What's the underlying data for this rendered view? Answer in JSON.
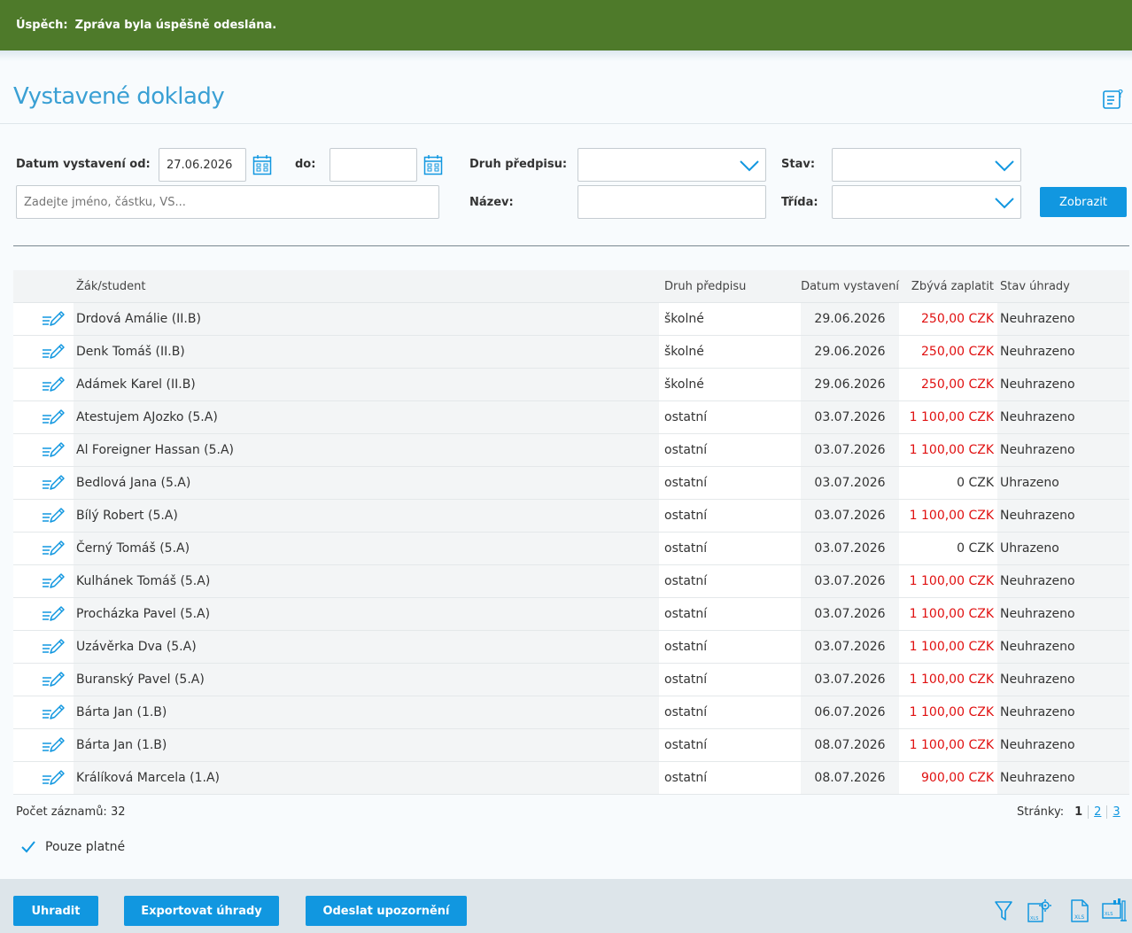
{
  "banner": {
    "label": "Úspěch:",
    "message": "Zpráva byla úspěšně odeslána."
  },
  "page": {
    "title": "Vystavené doklady"
  },
  "filters": {
    "date_from_label": "Datum vystavení od:",
    "date_from_value": "27.06.2026",
    "date_to_label": "do:",
    "date_to_value": "",
    "druh_label": "Druh předpisu:",
    "druh_value": "",
    "stav_label": "Stav:",
    "stav_value": "",
    "search_placeholder": "Zadejte jméno, částku, VS...",
    "nazev_label": "Název:",
    "nazev_value": "",
    "trida_label": "Třída:",
    "trida_value": "",
    "show_button": "Zobrazit"
  },
  "table": {
    "headers": {
      "student": "Žák/student",
      "druh": "Druh předpisu",
      "datum": "Datum vystavení",
      "zbyva": "Zbývá zaplatit",
      "stav": "Stav úhrady"
    },
    "rows": [
      {
        "name": "Drdová Amálie (II.B)",
        "druh": "školné",
        "datum": "29.06.2026",
        "zbyva": "250,00 CZK",
        "stav": "Neuhrazeno",
        "due": true
      },
      {
        "name": "Denk Tomáš (II.B)",
        "druh": "školné",
        "datum": "29.06.2026",
        "zbyva": "250,00 CZK",
        "stav": "Neuhrazeno",
        "due": true
      },
      {
        "name": "Adámek Karel (II.B)",
        "druh": "školné",
        "datum": "29.06.2026",
        "zbyva": "250,00 CZK",
        "stav": "Neuhrazeno",
        "due": true
      },
      {
        "name": "Atestujem AJozko (5.A)",
        "druh": "ostatní",
        "datum": "03.07.2026",
        "zbyva": "1 100,00 CZK",
        "stav": "Neuhrazeno",
        "due": true
      },
      {
        "name": "Al Foreigner Hassan (5.A)",
        "druh": "ostatní",
        "datum": "03.07.2026",
        "zbyva": "1 100,00 CZK",
        "stav": "Neuhrazeno",
        "due": true
      },
      {
        "name": "Bedlová Jana (5.A)",
        "druh": "ostatní",
        "datum": "03.07.2026",
        "zbyva": "0 CZK",
        "stav": "Uhrazeno",
        "due": false
      },
      {
        "name": "Bílý Robert (5.A)",
        "druh": "ostatní",
        "datum": "03.07.2026",
        "zbyva": "1 100,00 CZK",
        "stav": "Neuhrazeno",
        "due": true
      },
      {
        "name": "Černý Tomáš (5.A)",
        "druh": "ostatní",
        "datum": "03.07.2026",
        "zbyva": "0 CZK",
        "stav": "Uhrazeno",
        "due": false
      },
      {
        "name": "Kulhánek Tomáš (5.A)",
        "druh": "ostatní",
        "datum": "03.07.2026",
        "zbyva": "1 100,00 CZK",
        "stav": "Neuhrazeno",
        "due": true
      },
      {
        "name": "Procházka Pavel (5.A)",
        "druh": "ostatní",
        "datum": "03.07.2026",
        "zbyva": "1 100,00 CZK",
        "stav": "Neuhrazeno",
        "due": true
      },
      {
        "name": "Uzávěrka Dva (5.A)",
        "druh": "ostatní",
        "datum": "03.07.2026",
        "zbyva": "1 100,00 CZK",
        "stav": "Neuhrazeno",
        "due": true
      },
      {
        "name": "Buranský Pavel (5.A)",
        "druh": "ostatní",
        "datum": "03.07.2026",
        "zbyva": "1 100,00 CZK",
        "stav": "Neuhrazeno",
        "due": true
      },
      {
        "name": "Bárta Jan (1.B)",
        "druh": "ostatní",
        "datum": "06.07.2026",
        "zbyva": "1 100,00 CZK",
        "stav": "Neuhrazeno",
        "due": true
      },
      {
        "name": "Bárta Jan (1.B)",
        "druh": "ostatní",
        "datum": "08.07.2026",
        "zbyva": "1 100,00 CZK",
        "stav": "Neuhrazeno",
        "due": true
      },
      {
        "name": "Králíková Marcela (1.A)",
        "druh": "ostatní",
        "datum": "08.07.2026",
        "zbyva": "900,00 CZK",
        "stav": "Neuhrazeno",
        "due": true
      }
    ]
  },
  "summary": {
    "count_label": "Počet záznamů: 32"
  },
  "pager": {
    "label": "Stránky:",
    "pages": [
      "1",
      "2",
      "3"
    ],
    "current": "1"
  },
  "options": {
    "only_valid": "Pouze platné"
  },
  "footer": {
    "pay_button": "Uhradit",
    "export_button": "Exportovat úhrady",
    "notify_button": "Odeslat upozornění",
    "icons": [
      "filter-icon",
      "xls-settings-icon",
      "xls-icon",
      "xls-chart-icon"
    ]
  },
  "colors": {
    "accent": "#1197e0",
    "banner": "#4e7a2a",
    "title": "#3aa0d4",
    "due": "#e01010"
  }
}
